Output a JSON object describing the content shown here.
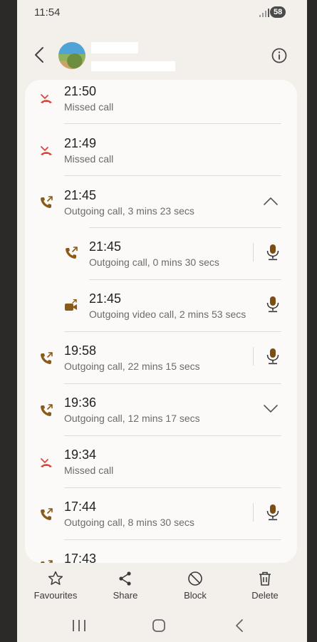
{
  "status": {
    "time": "11:54",
    "battery": "58"
  },
  "calls": [
    {
      "time": "21:50",
      "desc": "Missed call",
      "type": "missed"
    },
    {
      "time": "21:49",
      "desc": "Missed call",
      "type": "missed"
    },
    {
      "time": "21:45",
      "desc": "Outgoing call, 3 mins 23 secs",
      "type": "outgoing",
      "expanded": true
    },
    {
      "time": "21:45",
      "desc": "Outgoing call, 0 mins 30 secs",
      "type": "outgoing",
      "recording": true
    },
    {
      "time": "21:45",
      "desc": "Outgoing video call, 2 mins 53 secs",
      "type": "video",
      "recording": true
    },
    {
      "time": "19:58",
      "desc": "Outgoing call, 22 mins 15 secs",
      "type": "outgoing",
      "recording": true
    },
    {
      "time": "19:36",
      "desc": "Outgoing call, 12 mins 17 secs",
      "type": "outgoing",
      "expanded": false
    },
    {
      "time": "19:34",
      "desc": "Missed call",
      "type": "missed"
    },
    {
      "time": "17:44",
      "desc": "Outgoing call, 8 mins 30 secs",
      "type": "outgoing",
      "recording": true
    },
    {
      "time": "17:43",
      "desc": "",
      "type": "outgoing"
    }
  ],
  "actions": {
    "favourites": "Favourites",
    "share": "Share",
    "block": "Block",
    "delete": "Delete"
  },
  "colors": {
    "missed": "#d7463b",
    "outgoing": "#8a5a1a",
    "accent": "#7b4e13"
  }
}
